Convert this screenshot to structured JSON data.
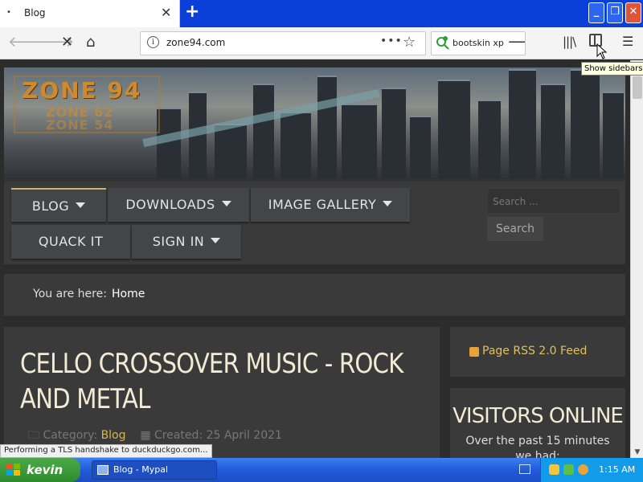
{
  "browser": {
    "tab_title": "Blog",
    "tab_bullet": "•",
    "tab_close": "✕",
    "new_tab": "+",
    "url": "zone94.com",
    "url_more": "•••",
    "search_text": "bootskin xp",
    "tooltip": "Show sidebars",
    "status": "Performing a TLS handshake to duckduckgo.com..."
  },
  "site": {
    "logo_main": "ZONE 94",
    "logo_sub1": "ZONE 62",
    "logo_sub2": "ZONE 54",
    "menu": [
      {
        "label": "BLOG"
      },
      {
        "label": "DOWNLOADS"
      },
      {
        "label": "IMAGE GALLERY"
      },
      {
        "label": "QUACK IT"
      },
      {
        "label": "SIGN IN"
      }
    ],
    "search_placeholder": "Search ...",
    "search_button": "Search",
    "breadcrumb_label": "You are here:",
    "breadcrumb_home": "Home",
    "article_title": "CELLO CROSSOVER MUSIC - ROCK AND METAL",
    "category_label": "Category:",
    "category_value": "Blog",
    "created_label": "Created: 25 April 2021",
    "rss_label": "Page RSS 2.0 Feed",
    "visitors_title": "VISITORS ONLINE",
    "visitors_line1": "Over the past 15 minutes",
    "visitors_line2": "we had:"
  },
  "taskbar": {
    "start_label": "kevin",
    "task_label": "Blog - Mypal",
    "clock": "1:15 AM"
  },
  "colors": {
    "accent_gold": "#d8b548",
    "title_text": "#f2ead2",
    "xp_blue": "#235ad9",
    "xp_green": "#2f8c2d"
  }
}
